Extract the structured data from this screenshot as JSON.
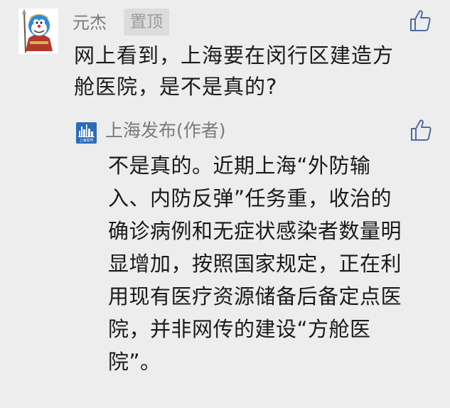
{
  "comment": {
    "user_name": "元杰",
    "badge": "置顶",
    "text_lines": [
      "网上看到，上海要在闵行区建造方",
      "舱医院，是不是真的?"
    ],
    "like_icon": "thumbs-up-icon"
  },
  "reply": {
    "author_name": "上海发布(作者)",
    "author_logo_text": "上海发布",
    "text_lines": [
      "不是真的。近期上海“外防输",
      "入、内防反弹”任务重，收治的",
      "确诊病例和无症状感染者数量明",
      "显增加，按照国家规定，正在利",
      "用现有医疗资源储备后备定点医",
      "院，并非网传的建设“方舱医",
      "院”。"
    ],
    "like_icon": "thumbs-up-icon"
  },
  "colors": {
    "background": "#ededed",
    "name_gray": "#7a7a7a",
    "text": "#1a1a1a",
    "badge_bg": "#dcdcdc",
    "icon_blue": "#4f6aa3",
    "logo_blue": "#2b6cb8"
  }
}
